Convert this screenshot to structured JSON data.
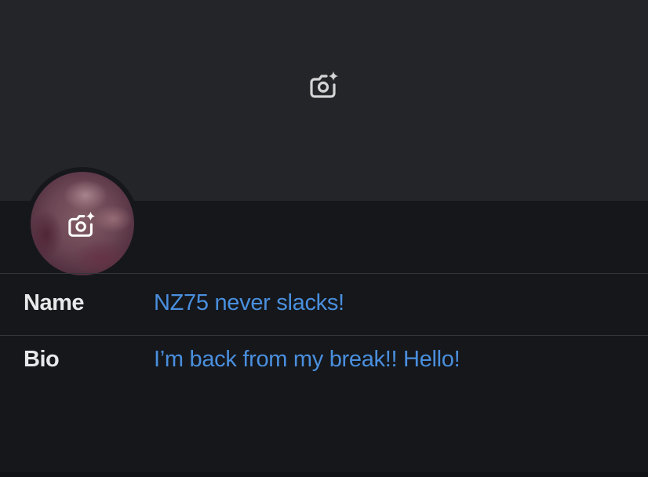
{
  "banner": {
    "camera_icon": "camera-add-icon"
  },
  "avatar": {
    "camera_icon": "camera-add-icon"
  },
  "fields": {
    "name_label": "Name",
    "name_value": "NZ75 never slacks!",
    "bio_label": "Bio",
    "bio_value": "I’m back from my break!! Hello!"
  },
  "colors": {
    "background": "#15171b",
    "banner": "#242528",
    "value_text": "#4a8fde",
    "label_text": "#e8e8ea"
  }
}
